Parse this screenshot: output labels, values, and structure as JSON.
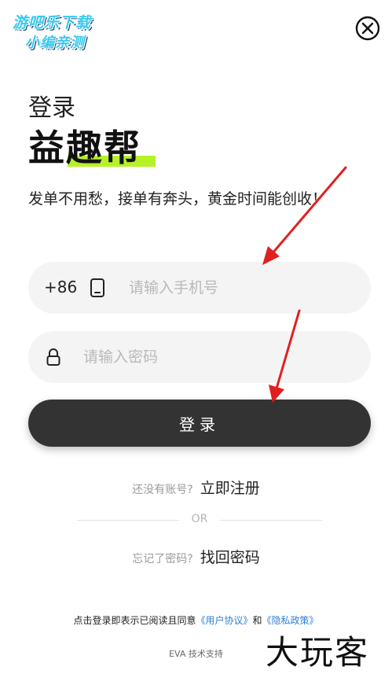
{
  "watermark": {
    "logo_line1": "游吧乐下载",
    "logo_line2": "小编亲测",
    "corner_text": "大玩客"
  },
  "header": {
    "close_icon": "close-icon"
  },
  "login": {
    "title": "登录",
    "brand": "益趣帮",
    "slogan": "发单不用愁，接单有奔头，黄金时间能创收！"
  },
  "phone": {
    "country_code": "+86",
    "icon": "phone-icon",
    "placeholder": "请输入手机号",
    "value": ""
  },
  "password": {
    "icon": "lock-icon",
    "placeholder": "请输入密码",
    "value": ""
  },
  "actions": {
    "login_label": "登录",
    "no_account_text": "还没有账号?",
    "register_label": "立即注册",
    "or_label": "OR",
    "forgot_text": "忘记了密码?",
    "recover_label": "找回密码"
  },
  "agreement": {
    "prefix": "点击登录即表示已阅读且同意",
    "user_agreement": "《用户协议》",
    "and": "和",
    "privacy_policy": "《隐私政策》"
  },
  "footer": {
    "support": "EVA 技术支持"
  },
  "colors": {
    "button_bg": "#333333",
    "brand_highlight": "#b6f227",
    "link": "#2d7fd6",
    "watermark_blue": "#38c9ef",
    "annotation_arrow": "#e02020"
  }
}
